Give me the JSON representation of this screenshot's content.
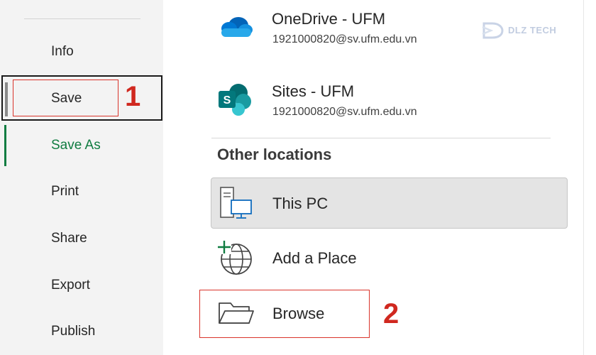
{
  "sidebar": {
    "items": [
      {
        "label": "Info"
      },
      {
        "label": "Save"
      },
      {
        "label": "Save As"
      },
      {
        "label": "Print"
      },
      {
        "label": "Share"
      },
      {
        "label": "Export"
      },
      {
        "label": "Publish"
      }
    ],
    "active_item": "Save As"
  },
  "locations": {
    "onedrive": {
      "title": "OneDrive - UFM",
      "subtitle": "1921000820@sv.ufm.edu.vn",
      "icon": "onedrive-cloud-icon"
    },
    "sites": {
      "title": "Sites - UFM",
      "subtitle": "1921000820@sv.ufm.edu.vn",
      "icon": "sharepoint-icon"
    }
  },
  "other_locations": {
    "heading": "Other locations",
    "items": [
      {
        "label": "This PC",
        "icon": "computer-icon",
        "selected": true
      },
      {
        "label": "Add a Place",
        "icon": "globe-add-icon"
      },
      {
        "label": "Browse",
        "icon": "folder-icon"
      }
    ]
  },
  "annotations": {
    "step1": "1",
    "step2": "2"
  },
  "watermark": {
    "text": "DLZ TECH"
  },
  "colors": {
    "accent_green": "#107c41",
    "annotation_red": "#d0281f",
    "onedrive_blue": "#0f6cbd",
    "sharepoint_teal": "#03787c"
  }
}
